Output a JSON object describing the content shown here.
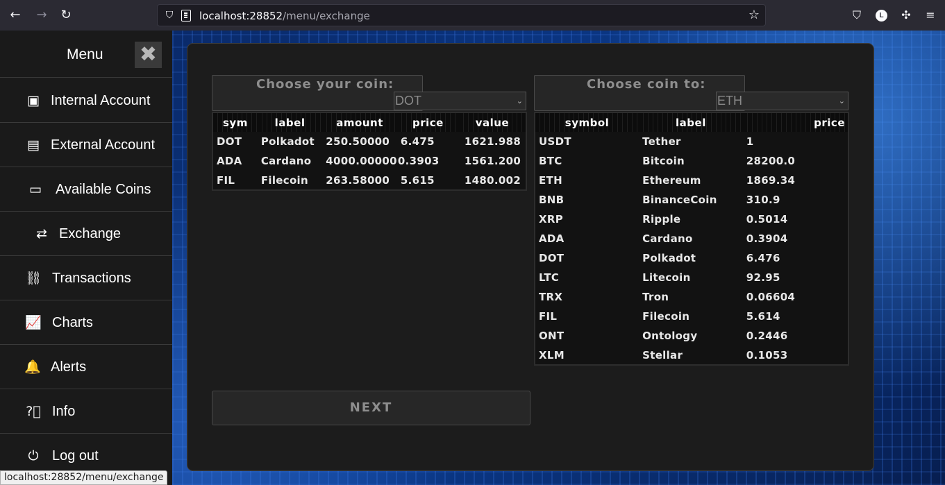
{
  "browser": {
    "url_host": "localhost:28852",
    "url_path": "/menu/exchange",
    "avatar_letter": "L",
    "status_url": "localhost:28852/menu/exchange"
  },
  "sidebar": {
    "title": "Menu",
    "close_icon": "✖",
    "items": [
      {
        "label": "Internal Account",
        "icon": "id-card-icon"
      },
      {
        "label": "External Account",
        "icon": "id-badge-icon"
      },
      {
        "label": "Available Coins",
        "icon": "money-bill-icon"
      },
      {
        "label": "Exchange",
        "icon": "exchange-arrows-icon"
      },
      {
        "label": "Transactions",
        "icon": "link-icon"
      },
      {
        "label": "Charts",
        "icon": "chart-line-icon"
      },
      {
        "label": "Alerts",
        "icon": "bell-icon"
      },
      {
        "label": "Info",
        "icon": "question-circle-icon"
      },
      {
        "label": "Log out",
        "icon": "power-icon"
      }
    ]
  },
  "from_panel": {
    "title": "Choose your coin:",
    "selected": "DOT",
    "columns": [
      "sym",
      "label",
      "amount",
      "price",
      "value"
    ],
    "rows": [
      [
        "DOT",
        "Polkadot",
        "250.50000",
        "6.475",
        "1621.988"
      ],
      [
        "ADA",
        "Cardano",
        "4000.00000",
        "0.3903",
        "1561.200"
      ],
      [
        "FIL",
        "Filecoin",
        "263.58000",
        "5.615",
        "1480.002"
      ]
    ]
  },
  "to_panel": {
    "title": "Choose coin to:",
    "selected": "ETH",
    "columns": [
      "symbol",
      "label",
      "price"
    ],
    "rows": [
      [
        "USDT",
        "Tether",
        "1"
      ],
      [
        "BTC",
        "Bitcoin",
        "28200.0"
      ],
      [
        "ETH",
        "Ethereum",
        "1869.34"
      ],
      [
        "BNB",
        "BinanceCoin",
        "310.9"
      ],
      [
        "XRP",
        "Ripple",
        "0.5014"
      ],
      [
        "ADA",
        "Cardano",
        "0.3904"
      ],
      [
        "DOT",
        "Polkadot",
        "6.476"
      ],
      [
        "LTC",
        "Litecoin",
        "92.95"
      ],
      [
        "TRX",
        "Tron",
        "0.06604"
      ],
      [
        "FIL",
        "Filecoin",
        "5.614"
      ],
      [
        "ONT",
        "Ontology",
        "0.2446"
      ],
      [
        "XLM",
        "Stellar",
        "0.1053"
      ]
    ]
  },
  "next_label": "NEXT"
}
